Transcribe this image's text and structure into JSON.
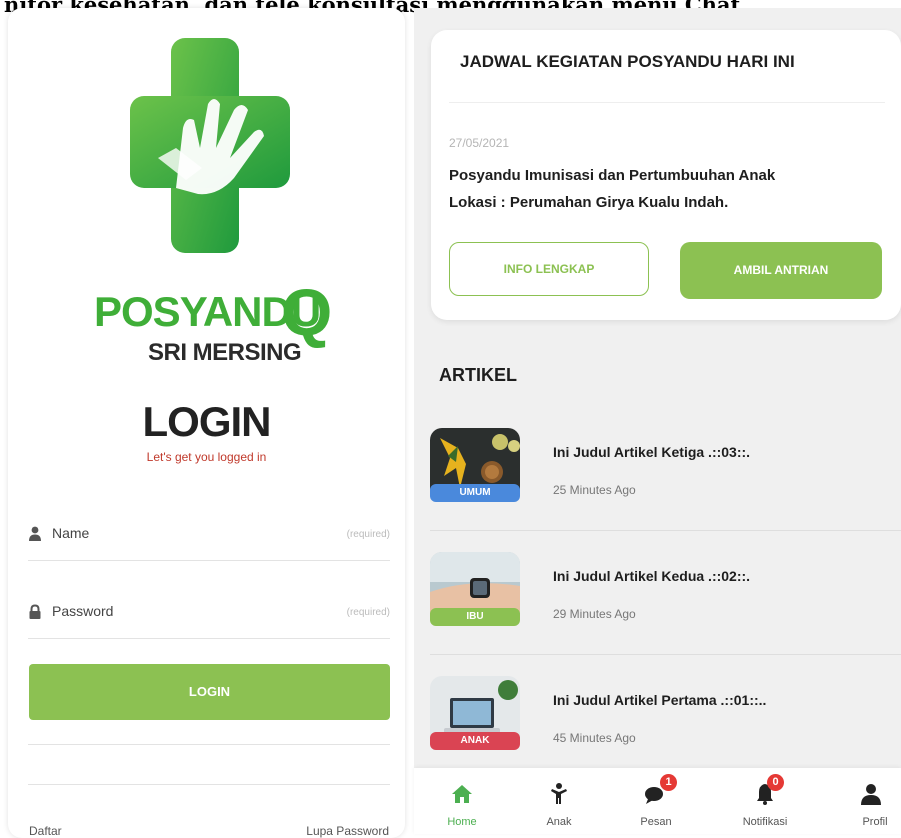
{
  "caption": "nitor kesehatan, dan tele konsultasi menggunakan menu Chat.",
  "login_screen": {
    "brand_main": "POSYANDU",
    "brand_q": "Q",
    "brand_sub": "SRI MERSING",
    "title": "LOGIN",
    "subtitle": "Let's get you logged in",
    "name_label": "Name",
    "name_hint": "(required)",
    "password_label": "Password",
    "password_hint": "(required)",
    "login_button": "LOGIN",
    "register_link": "Daftar",
    "forgot_link": "Lupa Password",
    "accent_color": "#8cc152"
  },
  "home_screen": {
    "schedule": {
      "title": "JADWAL KEGIATAN POSYANDU HARI INI",
      "date": "27/05/2021",
      "event": "Posyandu Imunisasi dan Pertumbuuhan Anak",
      "location": "Lokasi : Perumahan Girya Kualu Indah.",
      "info_button": "INFO LENGKAP",
      "queue_button": "AMBIL ANTRIAN"
    },
    "articles_title": "ARTIKEL",
    "articles": [
      {
        "title": "Ini Judul Artikel Ketiga .::03::.",
        "time": "25 Minutes Ago",
        "tag": "UMUM",
        "tag_color": "#4a89dc"
      },
      {
        "title": "Ini Judul Artikel Kedua .::02::.",
        "time": "29 Minutes Ago",
        "tag": "IBU",
        "tag_color": "#8cc152"
      },
      {
        "title": "Ini Judul Artikel Pertama .::01::..",
        "time": "45 Minutes Ago",
        "tag": "ANAK",
        "tag_color": "#da4453"
      }
    ],
    "nav": [
      {
        "label": "Home",
        "icon": "home-icon",
        "active": true
      },
      {
        "label": "Anak",
        "icon": "child-icon"
      },
      {
        "label": "Pesan",
        "icon": "chat-icon",
        "badge": "1"
      },
      {
        "label": "Notifikasi",
        "icon": "bell-icon",
        "badge": "0"
      },
      {
        "label": "Profil",
        "icon": "user-icon"
      }
    ]
  }
}
